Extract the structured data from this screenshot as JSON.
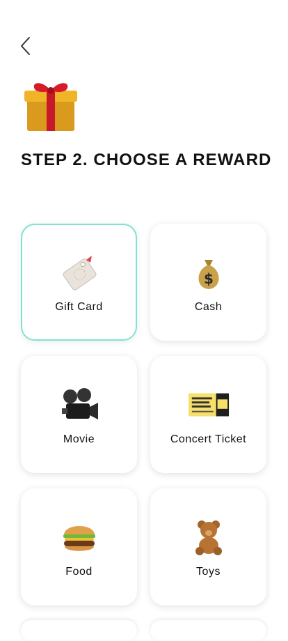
{
  "header": {
    "back_icon": "chevron-left-icon",
    "hero_icon": "gift-icon",
    "title": "STEP 2. CHOOSE A REWARD"
  },
  "rewards": [
    {
      "label": "Gift Card",
      "icon": "gift-card-icon",
      "selected": true
    },
    {
      "label": "Cash",
      "icon": "money-bag-icon",
      "selected": false
    },
    {
      "label": "Movie",
      "icon": "movie-camera-icon",
      "selected": false
    },
    {
      "label": "Concert Ticket",
      "icon": "ticket-icon",
      "selected": false
    },
    {
      "label": "Food",
      "icon": "burger-icon",
      "selected": false
    },
    {
      "label": "Toys",
      "icon": "teddy-bear-icon",
      "selected": false
    }
  ],
  "colors": {
    "selected_border": "#7fe3d2",
    "card_background": "#ffffff"
  }
}
